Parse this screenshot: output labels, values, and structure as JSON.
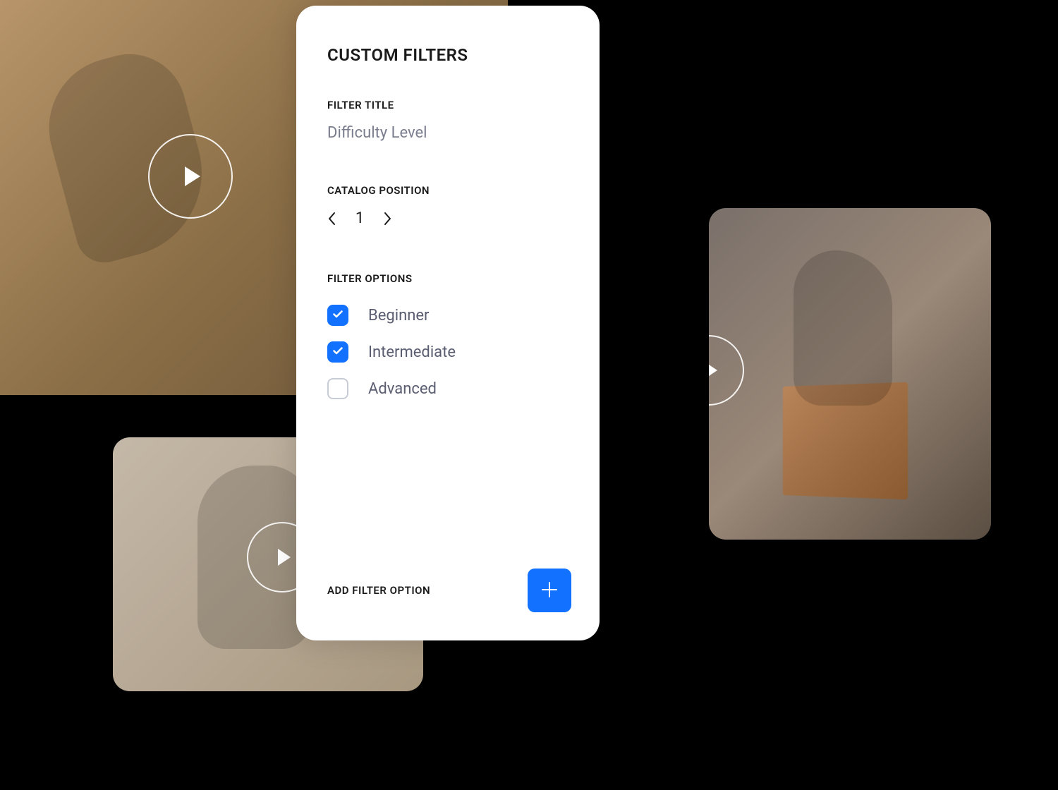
{
  "card": {
    "title": "CUSTOM FILTERS",
    "filter_title_label": "FILTER TITLE",
    "filter_title_value": "Difficulty Level",
    "catalog_position_label": "CATALOG POSITION",
    "catalog_position_value": "1",
    "filter_options_label": "FILTER OPTIONS",
    "options": [
      {
        "label": "Beginner",
        "checked": true
      },
      {
        "label": "Intermediate",
        "checked": true
      },
      {
        "label": "Advanced",
        "checked": false
      }
    ],
    "add_filter_label": "ADD FILTER OPTION"
  },
  "colors": {
    "accent": "#1371ff"
  }
}
